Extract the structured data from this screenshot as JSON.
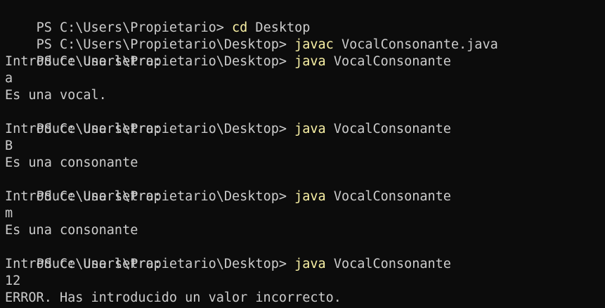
{
  "terminal": {
    "lines": [
      {
        "type": "prompt",
        "prompt": "PS C:\\Users\\Propietario> ",
        "cmd": "cd",
        "args": " Desktop"
      },
      {
        "type": "prompt",
        "prompt": "PS C:\\Users\\Propietario\\Desktop> ",
        "cmd": "javac",
        "args": " VocalConsonante.java"
      },
      {
        "type": "prompt",
        "prompt": "PS C:\\Users\\Propietario\\Desktop> ",
        "cmd": "java",
        "args": " VocalConsonante"
      },
      {
        "type": "output",
        "text": "Introduce una letra:"
      },
      {
        "type": "input",
        "text": "a"
      },
      {
        "type": "output",
        "text": "Es una vocal."
      },
      {
        "type": "prompt",
        "prompt": "PS C:\\Users\\Propietario\\Desktop> ",
        "cmd": "java",
        "args": " VocalConsonante"
      },
      {
        "type": "output",
        "text": "Introduce una letra:"
      },
      {
        "type": "input",
        "text": "B"
      },
      {
        "type": "output",
        "text": "Es una consonante"
      },
      {
        "type": "prompt",
        "prompt": "PS C:\\Users\\Propietario\\Desktop> ",
        "cmd": "java",
        "args": " VocalConsonante"
      },
      {
        "type": "output",
        "text": "Introduce una letra:"
      },
      {
        "type": "input",
        "text": "m"
      },
      {
        "type": "output",
        "text": "Es una consonante"
      },
      {
        "type": "prompt",
        "prompt": "PS C:\\Users\\Propietario\\Desktop> ",
        "cmd": "java",
        "args": " VocalConsonante"
      },
      {
        "type": "output",
        "text": "Introduce una letra:"
      },
      {
        "type": "input",
        "text": "12"
      },
      {
        "type": "output",
        "text": "ERROR. Has introducido un valor incorrecto."
      }
    ]
  },
  "colors": {
    "background": "#0c0c0c",
    "foreground": "#cccccc",
    "command": "#f9f1a5"
  }
}
